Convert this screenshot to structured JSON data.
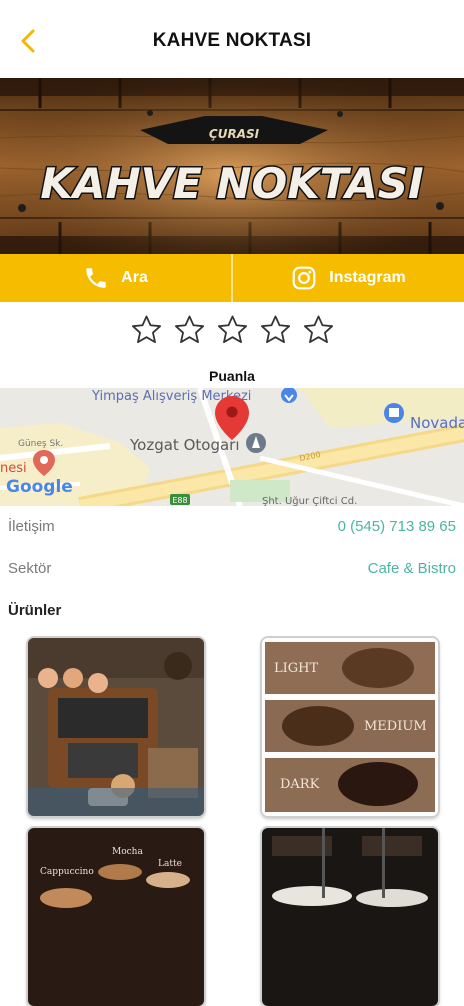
{
  "header": {
    "title": "KAHVE NOKTASI",
    "back_icon": "chevron-left-icon"
  },
  "banner": {
    "small_text": "ÇURASI",
    "big_text": "KAHVE NOKTASI"
  },
  "actions": [
    {
      "label": "Ara",
      "icon": "phone-icon"
    },
    {
      "label": "Instagram",
      "icon": "instagram-icon"
    }
  ],
  "rating": {
    "value": 0,
    "max": 5,
    "label": "Puanla"
  },
  "map": {
    "labels": {
      "mall": "Yimpaş Alışveriş Merkezi",
      "bus_station": "Yozgat Otogarı",
      "novada": "Novada",
      "street": "Şht. Uğur Çiftci Cd.",
      "gunes": "Güneş Sk.",
      "partial": "nesi",
      "road": "D200",
      "e88": "E88",
      "google": "Google"
    }
  },
  "info": {
    "contact_label": "İletişim",
    "contact_value": "0 (545) 713 89 65",
    "sector_label": "Sektör",
    "sector_value": "Cafe & Bistro"
  },
  "products": {
    "title": "Ürünler",
    "coffee_levels": [
      "LIGHT",
      "MEDIUM",
      "DARK"
    ],
    "drink_labels": [
      "Mocha",
      "Latte",
      "Cappuccino"
    ]
  },
  "colors": {
    "accent": "#f6bc00",
    "link": "#4db3a2",
    "back": "#f5b700",
    "pin": "#e53935"
  }
}
